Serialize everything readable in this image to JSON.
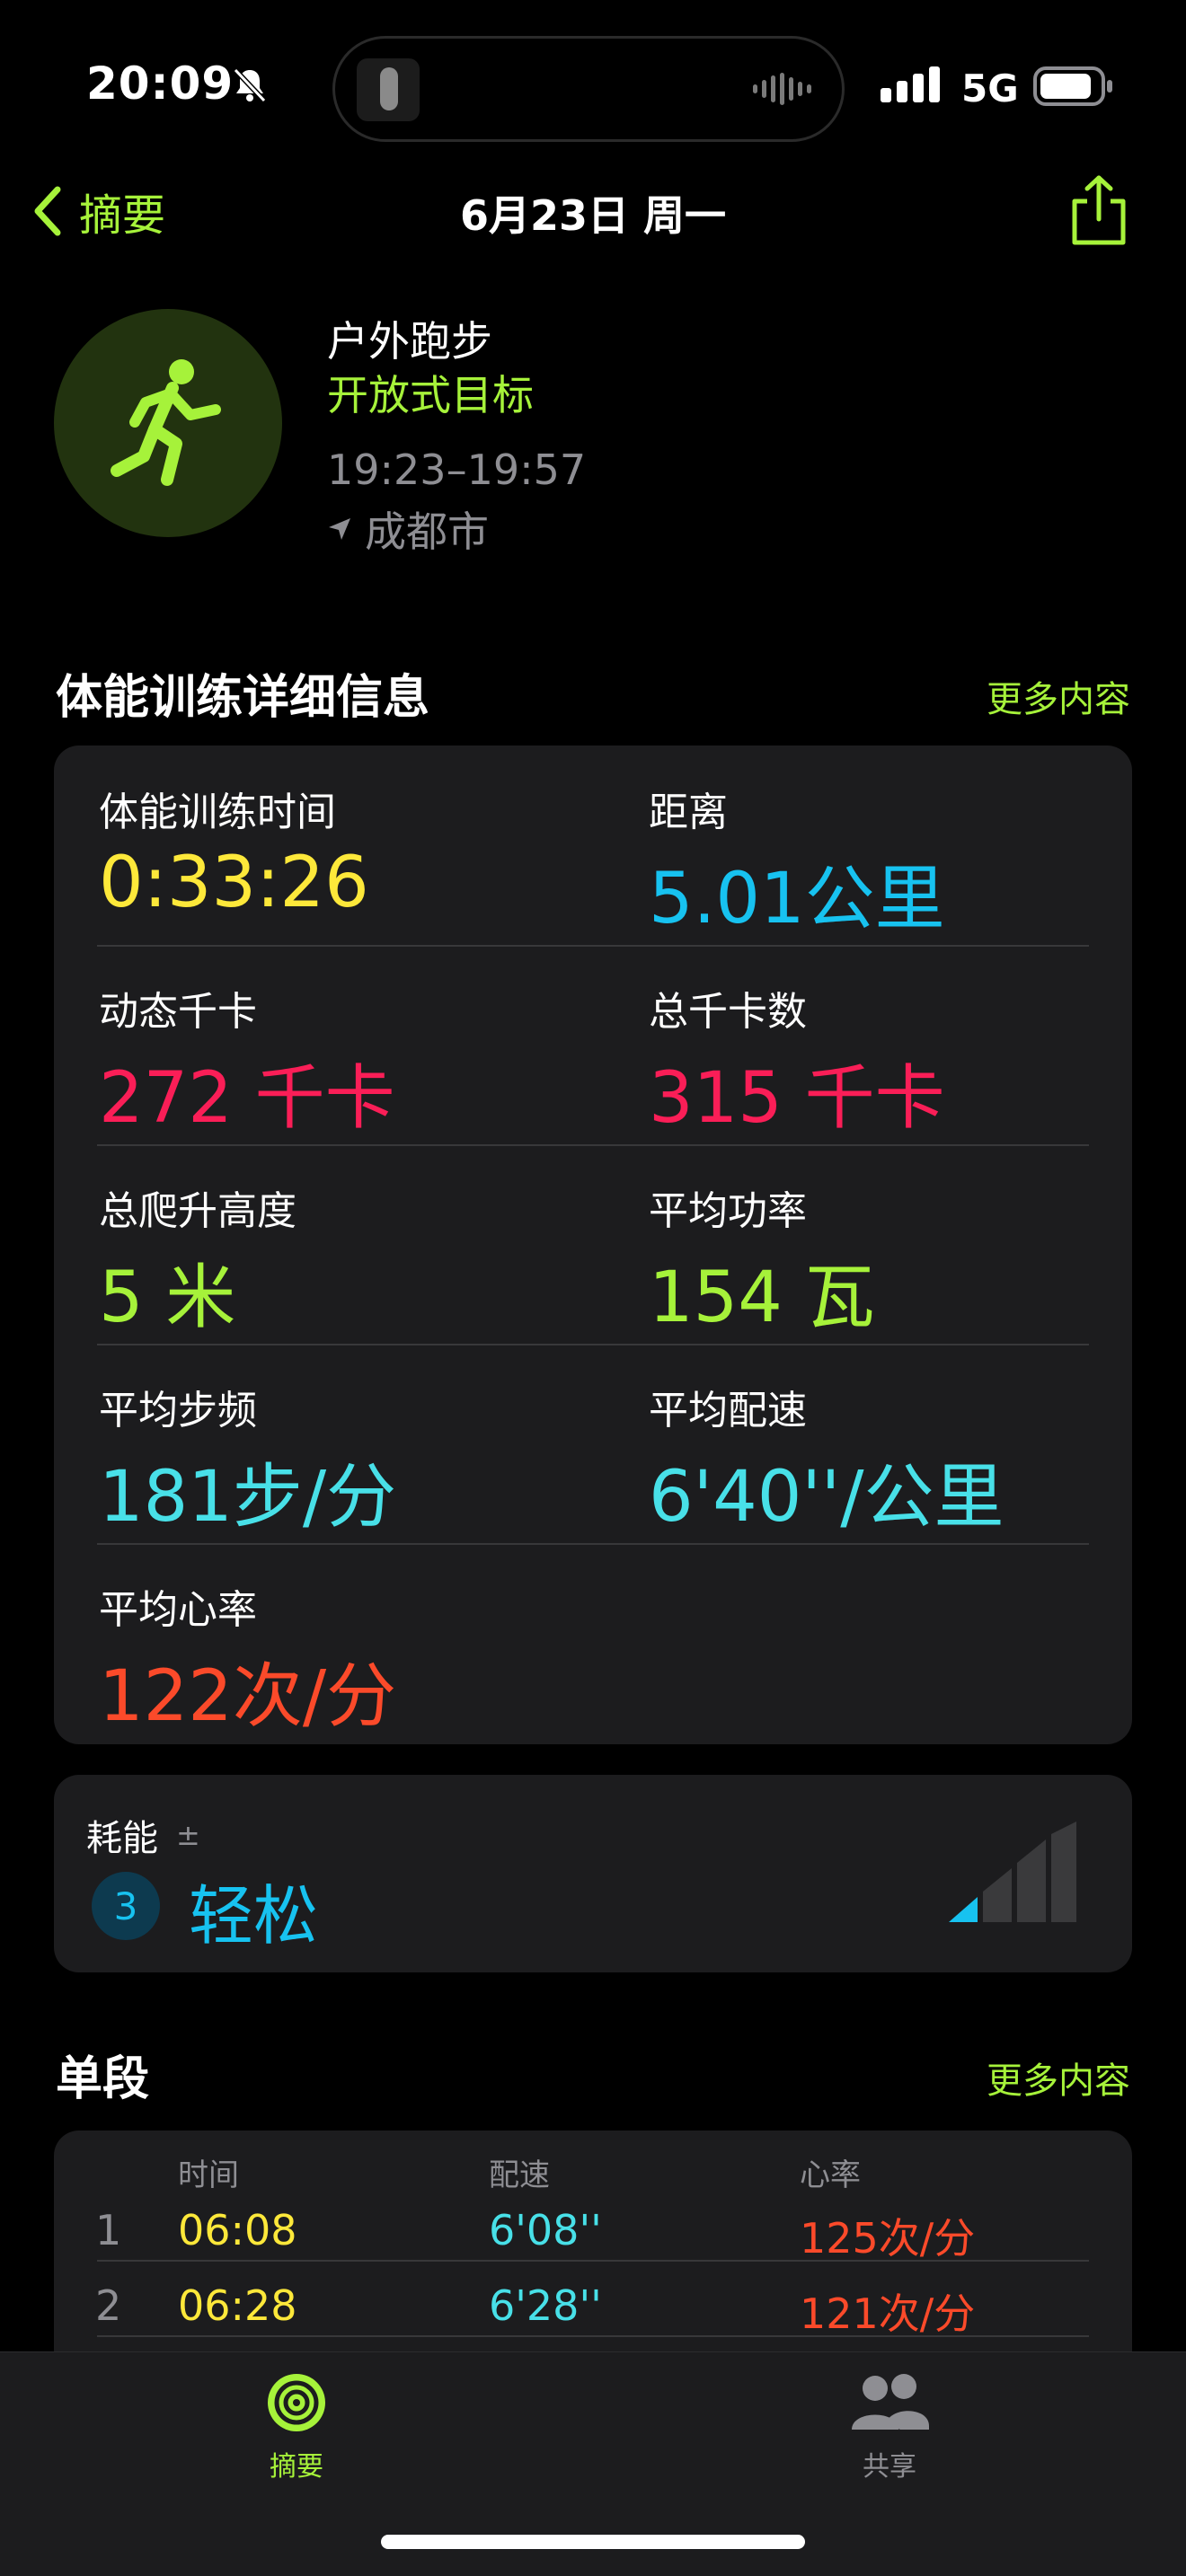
{
  "status_bar": {
    "time": "20:09",
    "network": "5G"
  },
  "nav": {
    "back_label": "摘要",
    "title": "6月23日 周一"
  },
  "workout": {
    "type": "户外跑步",
    "goal": "开放式目标",
    "time_range": "19:23–19:57",
    "location": "成都市"
  },
  "details_section": {
    "title": "体能训练详细信息",
    "more": "更多内容"
  },
  "metrics": {
    "duration": {
      "label": "体能训练时间",
      "value": "0:33:26",
      "color": "#fde83a"
    },
    "distance": {
      "label": "距离",
      "value": "5.01公里",
      "color": "#17c2f0"
    },
    "active_kcal": {
      "label": "动态千卡",
      "value": "272 千卡",
      "color": "#fa1e57"
    },
    "total_kcal": {
      "label": "总千卡数",
      "value": "315 千卡",
      "color": "#fa1e57"
    },
    "elevation": {
      "label": "总爬升高度",
      "value": "5 米",
      "color": "#a6f23a"
    },
    "avg_power": {
      "label": "平均功率",
      "value": "154 瓦",
      "color": "#a6f23a"
    },
    "avg_cadence": {
      "label": "平均步频",
      "value": "181步/分",
      "color": "#48e0e8"
    },
    "avg_pace": {
      "label": "平均配速",
      "value": "6'40''/公里",
      "color": "#48e0e8"
    },
    "avg_hr": {
      "label": "平均心率",
      "value": "122次/分",
      "color": "#fb4a2a"
    }
  },
  "effort": {
    "label": "耗能",
    "symbol": "±",
    "level": "3",
    "word": "轻松",
    "level_fraction": 0.3
  },
  "splits_section": {
    "title": "单段",
    "more": "更多内容"
  },
  "splits": {
    "headers": {
      "time": "时间",
      "pace": "配速",
      "hr": "心率"
    },
    "rows": [
      {
        "idx": "1",
        "time": "06:08",
        "pace": "6'08''",
        "hr": "125次/分"
      },
      {
        "idx": "2",
        "time": "06:28",
        "pace": "6'28''",
        "hr": "121次/分"
      }
    ]
  },
  "tabbar": {
    "summary": "摘要",
    "sharing": "共享"
  },
  "colors": {
    "accent": "#a6f23a",
    "card": "#1c1c1e"
  }
}
